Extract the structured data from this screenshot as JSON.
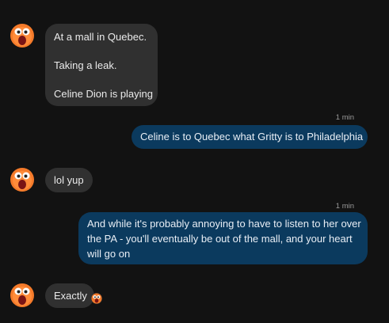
{
  "messages": [
    {
      "side": "in",
      "lines": [
        "At a mall in Quebec.",
        "Taking a leak.",
        "Celine Dion is playing"
      ]
    },
    {
      "side": "out",
      "timestamp": "1 min",
      "text": "Celine is to Quebec what Gritty is to Philadelphia"
    },
    {
      "side": "in",
      "text": "lol yup"
    },
    {
      "side": "out",
      "timestamp": "1 min",
      "lines": [
        "And while it's probably annoying to have to listen to her over",
        "the PA - you'll eventually be out of the mall, and your heart",
        "will go on"
      ]
    },
    {
      "side": "in",
      "text": "Exactly",
      "reaction_icon": "gritty-emoji-icon"
    }
  ],
  "colors": {
    "background": "#121212",
    "incoming_bubble": "#303030",
    "outgoing_bubble": "#0b3a5e",
    "text": "#eaeaea",
    "timestamp": "#9a9a9a"
  }
}
